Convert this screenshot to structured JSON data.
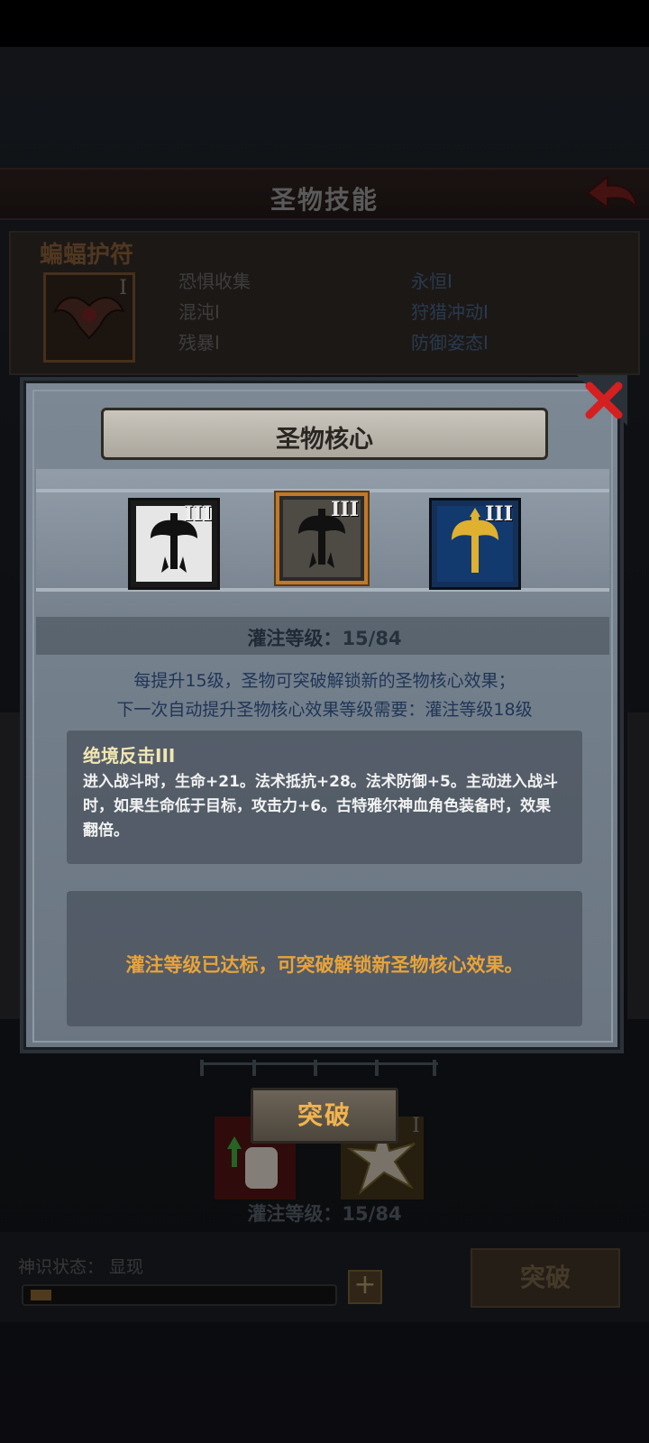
{
  "screen": {
    "title": "圣物技能",
    "relic": {
      "name": "蝙蝠护符",
      "rank": "I",
      "skills_left": [
        "恐惧收集",
        "混沌I",
        "残暴I"
      ],
      "skills_right": [
        "永恒I",
        "狩猎冲动I",
        "防御姿态I"
      ]
    },
    "bottom": {
      "skill_rank": "I",
      "infusion_level": "灌注等级：15/84",
      "divine_state": "神识状态： 显现",
      "divine_progress": 0.07,
      "break_label": "突破"
    }
  },
  "modal": {
    "title": "圣物核心",
    "cores": [
      {
        "rank": "III",
        "icon": "axe-sword-emblem-icon",
        "state": "white"
      },
      {
        "rank": "III",
        "icon": "axe-sword-emblem-icon",
        "state": "selected"
      },
      {
        "rank": "III",
        "icon": "axe-sword-emblem-icon",
        "state": "gold"
      }
    ],
    "infusion_label": "灌注等级：",
    "infusion_value": "15/84",
    "description_line1": "每提升15级，圣物可突破解锁新的圣物核心效果；",
    "description_line2": "下一次自动提升圣物核心效果等级需要：灌注等级18级",
    "effect": {
      "title": "绝境反击III",
      "text": "进入战斗时，生命+21。法术抵抗+28。法术防御+5。主动进入战斗时，如果生命低于目标，攻击力+6。古特雅尔神血角色装备时，效果翻倍。"
    },
    "notice": "灌注等级已达标，可突破解锁新圣物核心效果。",
    "break_label": "突破"
  },
  "colors": {
    "accent_orange": "#e8a33a",
    "effect_title": "#f0e6b2",
    "description_blue": "#1f3556",
    "selected_border": "#c0782a",
    "close_red": "#d42020"
  }
}
